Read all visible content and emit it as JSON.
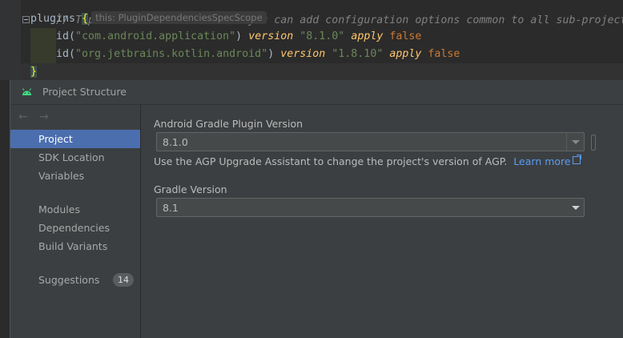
{
  "editor": {
    "comment": "// Top-level build file where you can add configuration options common to all sub-projects/mo",
    "plugins_keyword": "plugins",
    "open_brace": "{",
    "scope_hint": "this: PluginDependenciesSpecScope",
    "lines": [
      {
        "fn": "id",
        "arg": "\"com.android.application\"",
        "version_kw": "version",
        "version": "\"8.1.0\"",
        "apply_kw": "apply",
        "apply_val": "false"
      },
      {
        "fn": "id",
        "arg": "\"org.jetbrains.kotlin.android\"",
        "version_kw": "version",
        "version": "\"1.8.10\"",
        "apply_kw": "apply",
        "apply_val": "false"
      }
    ],
    "close_brace": "}"
  },
  "dialog": {
    "title": "Project Structure",
    "icon": "android-icon",
    "nav": {
      "back": "←",
      "forward": "→"
    },
    "sidebar": {
      "items": [
        {
          "label": "Project",
          "selected": true
        },
        {
          "label": "SDK Location"
        },
        {
          "label": "Variables"
        },
        {
          "label": "Modules"
        },
        {
          "label": "Dependencies"
        },
        {
          "label": "Build Variants"
        },
        {
          "label": "Suggestions",
          "badge": "14"
        }
      ]
    },
    "agp": {
      "label": "Android Gradle Plugin Version",
      "value": "8.1.0",
      "help": "Use the AGP Upgrade Assistant to change the project's version of AGP.",
      "link": "Learn more"
    },
    "gradle": {
      "label": "Gradle Version",
      "value": "8.1"
    }
  },
  "colors": {
    "selection": "#4b6eaf",
    "link": "#589df6",
    "keyword": "#cc7832",
    "string": "#6a8759"
  }
}
